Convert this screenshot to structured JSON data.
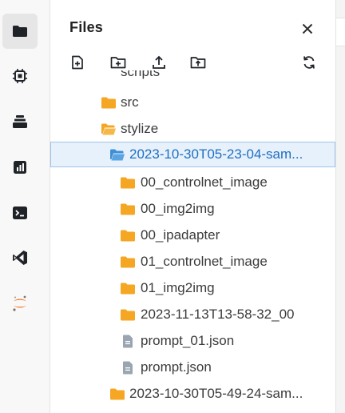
{
  "activity_bar": {
    "items": [
      {
        "name": "files",
        "icon": "folder-icon",
        "active": true
      },
      {
        "name": "cpu",
        "icon": "chip-icon",
        "active": false
      },
      {
        "name": "layers",
        "icon": "stack-icon",
        "active": false
      },
      {
        "name": "metrics",
        "icon": "bar-chart-icon",
        "active": false
      },
      {
        "name": "terminal",
        "icon": "terminal-icon",
        "active": false
      },
      {
        "name": "vscode",
        "icon": "vscode-icon",
        "active": false
      },
      {
        "name": "jupyter",
        "icon": "jupyter-icon",
        "active": false
      }
    ]
  },
  "panel": {
    "title": "Files",
    "close_icon": "close-icon",
    "toolbar": [
      {
        "name": "new-file",
        "icon": "new-file-icon"
      },
      {
        "name": "new-folder",
        "icon": "new-folder-icon"
      },
      {
        "name": "upload",
        "icon": "upload-icon"
      },
      {
        "name": "upload-folder",
        "icon": "upload-folder-icon"
      },
      {
        "name": "refresh",
        "icon": "refresh-icon"
      }
    ]
  },
  "tree": {
    "partial_label": "scripts",
    "rows": [
      {
        "label": "src",
        "type": "folder",
        "open": false,
        "depth": 1
      },
      {
        "label": "stylize",
        "type": "folder",
        "open": true,
        "depth": 1
      },
      {
        "label": "2023-10-30T05-23-04-sam...",
        "type": "folder",
        "open": true,
        "depth": 2,
        "selected": true
      },
      {
        "label": "00_controlnet_image",
        "type": "folder",
        "open": false,
        "depth": 3
      },
      {
        "label": "00_img2img",
        "type": "folder",
        "open": false,
        "depth": 3
      },
      {
        "label": "00_ipadapter",
        "type": "folder",
        "open": false,
        "depth": 3
      },
      {
        "label": "01_controlnet_image",
        "type": "folder",
        "open": false,
        "depth": 3
      },
      {
        "label": "01_img2img",
        "type": "folder",
        "open": false,
        "depth": 3
      },
      {
        "label": "2023-11-13T13-58-32_00",
        "type": "folder",
        "open": false,
        "depth": 3
      },
      {
        "label": "prompt_01.json",
        "type": "file",
        "depth": 3
      },
      {
        "label": "prompt.json",
        "type": "file",
        "depth": 3
      },
      {
        "label": "2023-10-30T05-49-24-sam...",
        "type": "folder",
        "open": false,
        "depth": 2
      }
    ]
  },
  "colors": {
    "folder": "#f5a623",
    "file": "#9aa5b1",
    "selected_bg": "#e7f1fb",
    "selected_border": "#9fc3e8",
    "selected_text": "#1f6fc2",
    "selected_folder": "#3d8fd6"
  }
}
